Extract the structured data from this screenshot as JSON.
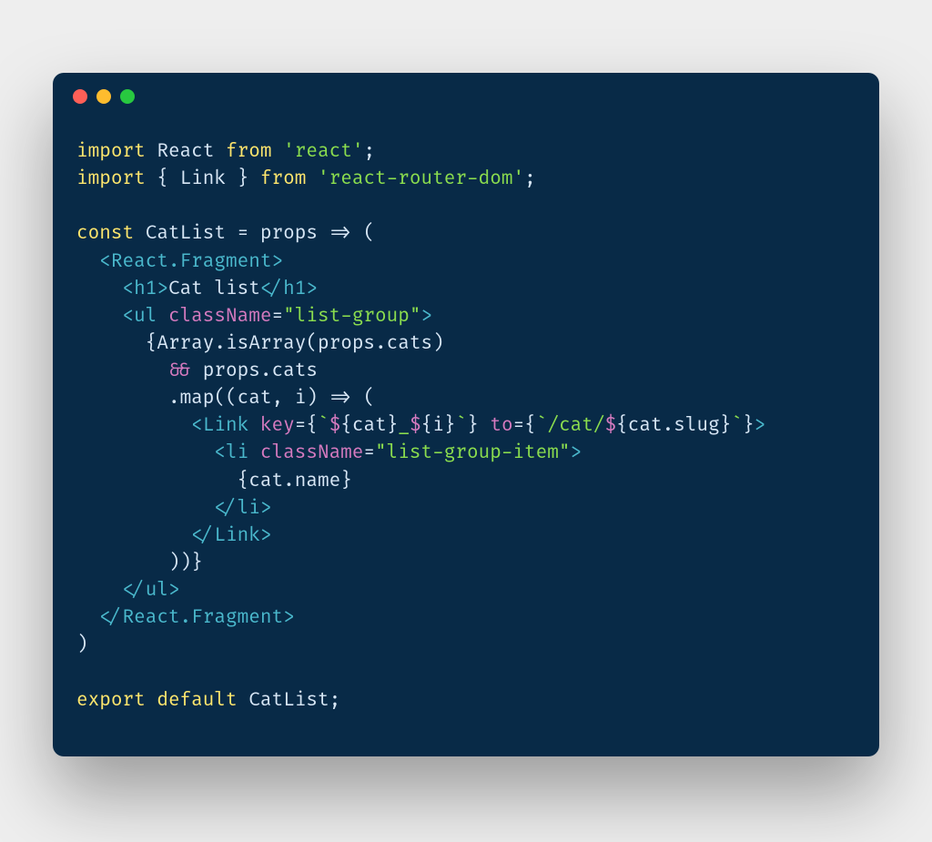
{
  "window": {
    "dots": [
      "red",
      "yellow",
      "green"
    ]
  },
  "code": {
    "l1": {
      "kw1": "import",
      "react": "React",
      "kw2": "from",
      "str": "'react'",
      "semi": ";"
    },
    "l2": {
      "kw1": "import",
      "lb": "{ ",
      "link": "Link",
      "rb": " }",
      "kw2": "from",
      "str": "'react-router-dom'",
      "semi": ";"
    },
    "l4": {
      "kw": "const",
      "name": "CatList",
      "eq": " = ",
      "props": "props",
      "arrow": " => (",
      "close": ""
    },
    "l5": {
      "open": "<",
      "tag": "React.Fragment",
      "close": ">"
    },
    "l6": {
      "open": "<",
      "tag": "h1",
      "close": ">",
      "text": "Cat list",
      "open2": "</",
      "tag2": "h1",
      "close2": ">"
    },
    "l7": {
      "open": "<",
      "tag": "ul",
      "attr": "className",
      "eq": "=",
      "str": "\"list-group\"",
      "close": ">"
    },
    "l8": {
      "lb": "{",
      "arr": "Array",
      "dot": ".",
      "isarr": "isArray",
      "lp": "(",
      "props": "props",
      "dot2": ".",
      "cats": "cats",
      "rp": ")"
    },
    "l9": {
      "andand": "&&",
      "props": "props",
      "dot": ".",
      "cats": "cats"
    },
    "l10": {
      "dot": ".",
      "map": "map",
      "lp": "((",
      "cat": "cat",
      "comma": ", ",
      "i": "i",
      "rp": ")",
      "arrow": " => ("
    },
    "l11": {
      "open": "<",
      "tag": "Link",
      "sp": " ",
      "attr1": "key",
      "eq1": "=",
      "lb1": "{",
      "bt1": "`",
      "d1": "$",
      "ob1": "{",
      "cat": "cat",
      "cb1": "}",
      "us": "_",
      "d2": "$",
      "ob2": "{",
      "i": "i",
      "cb2": "}",
      "bt1b": "`",
      "rb1": "}",
      "sp2": " ",
      "attr2": "to",
      "eq2": "=",
      "lb2": "{",
      "bt2": "`",
      "path": "/cat/",
      "d3": "$",
      "ob3": "{",
      "cat2": "cat",
      "dot": ".",
      "slug": "slug",
      "cb3": "}",
      "bt2b": "`",
      "rb2": "}",
      "close": ">"
    },
    "l12": {
      "open": "<",
      "tag": "li",
      "attr": "className",
      "eq": "=",
      "str": "\"list-group-item\"",
      "close": ">"
    },
    "l13": {
      "lb": "{",
      "cat": "cat",
      "dot": ".",
      "name": "name",
      "rb": "}"
    },
    "l14": {
      "open": "</",
      "tag": "li",
      "close": ">"
    },
    "l15": {
      "open": "</",
      "tag": "Link",
      "close": ">"
    },
    "l16": {
      "txt": "))}"
    },
    "l17": {
      "open": "</",
      "tag": "ul",
      "close": ">"
    },
    "l18": {
      "open": "</",
      "tag": "React.Fragment",
      "close": ">"
    },
    "l19": {
      "txt": ")"
    },
    "l21": {
      "kw1": "export",
      "kw2": "default",
      "name": "CatList",
      "semi": ";"
    }
  }
}
